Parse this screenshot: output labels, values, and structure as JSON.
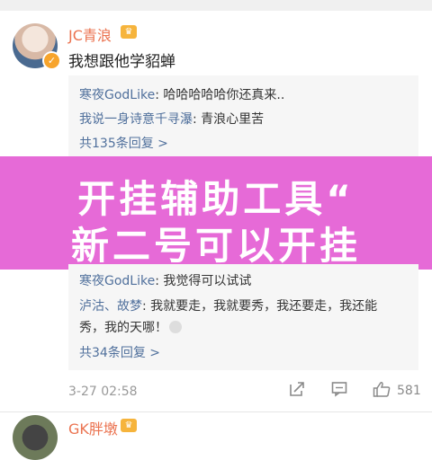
{
  "comment1": {
    "username": "JC青浪",
    "text": "我想跟他学貂蝉",
    "replies": [
      {
        "name": "寒夜GodLike",
        "text": ": 哈哈哈哈哈你还真来.."
      },
      {
        "name": "我说一身诗意千寻瀑",
        "text": ": 青浪心里苦"
      }
    ],
    "more_replies": "共135条回复 >"
  },
  "banner": {
    "line1": "开挂辅助工具“",
    "line2": "新二号可以开挂"
  },
  "thread2": {
    "replies": [
      {
        "name": "寒夜GodLike",
        "text": ": 我觉得可以试试"
      },
      {
        "name": "泸沽、故梦",
        "text": ": 我就要走，我就要秀，我还要走，我还能"
      }
    ],
    "reply_wrap": "秀，我的天哪！",
    "more_replies": "共34条回复 >"
  },
  "footer": {
    "timestamp": "3-27 02:58",
    "like_count": "581"
  },
  "comment2": {
    "username": "GK胖墩"
  },
  "colors": {
    "username": "#eb7350",
    "reply_name": "#50709c",
    "banner": "#e66ad7"
  },
  "icons": [
    "verified-icon",
    "vip-crown-icon",
    "share-icon",
    "comment-icon",
    "like-icon"
  ]
}
